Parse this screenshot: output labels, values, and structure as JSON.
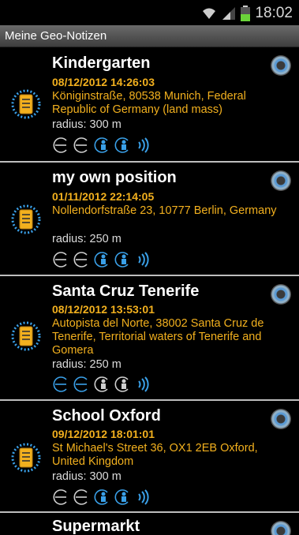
{
  "status": {
    "time": "18:02"
  },
  "app": {
    "title": "Meine Geo-Notizen"
  },
  "notes": [
    {
      "name": "Kindergarten",
      "date": "08/12/2012 14:26:03",
      "address": "Königinstraße, 80538 Munich, Federal Republic of Germany (land mass)",
      "radius": "radius: 300 m",
      "modes": [
        "walk-inactive",
        "walk-inactive",
        "person-active",
        "person-active",
        "wifi-active"
      ]
    },
    {
      "name": "my own position",
      "date": "01/11/2012 22:14:05",
      "address": "Nollendorfstraße 23, 10777 Berlin, Germany",
      "radius": "radius: 250 m",
      "modes": [
        "walk-inactive",
        "walk-inactive",
        "person-active",
        "person-active",
        "wifi-active"
      ]
    },
    {
      "name": "Santa Cruz Tenerife",
      "date": "08/12/2012 13:53:01",
      "address": "Autopista del Norte, 38002 Santa Cruz de Tenerife, Territorial waters of Tenerife and Gomera",
      "radius": "radius: 250 m",
      "modes": [
        "walk-active",
        "walk-active",
        "person-inactive",
        "person-inactive",
        "wifi-active"
      ]
    },
    {
      "name": "School Oxford",
      "date": "09/12/2012 18:01:01",
      "address": "St Michael's Street 36, OX1 2EB Oxford, United Kingdom",
      "radius": "radius: 300 m",
      "modes": [
        "walk-inactive",
        "walk-inactive",
        "person-active",
        "person-active",
        "wifi-active"
      ]
    },
    {
      "name": "Supermarkt"
    }
  ],
  "colors": {
    "accent_blue": "#3aa0e8",
    "date_orange": "#f2b01e",
    "divider": "#bdbdbd"
  }
}
